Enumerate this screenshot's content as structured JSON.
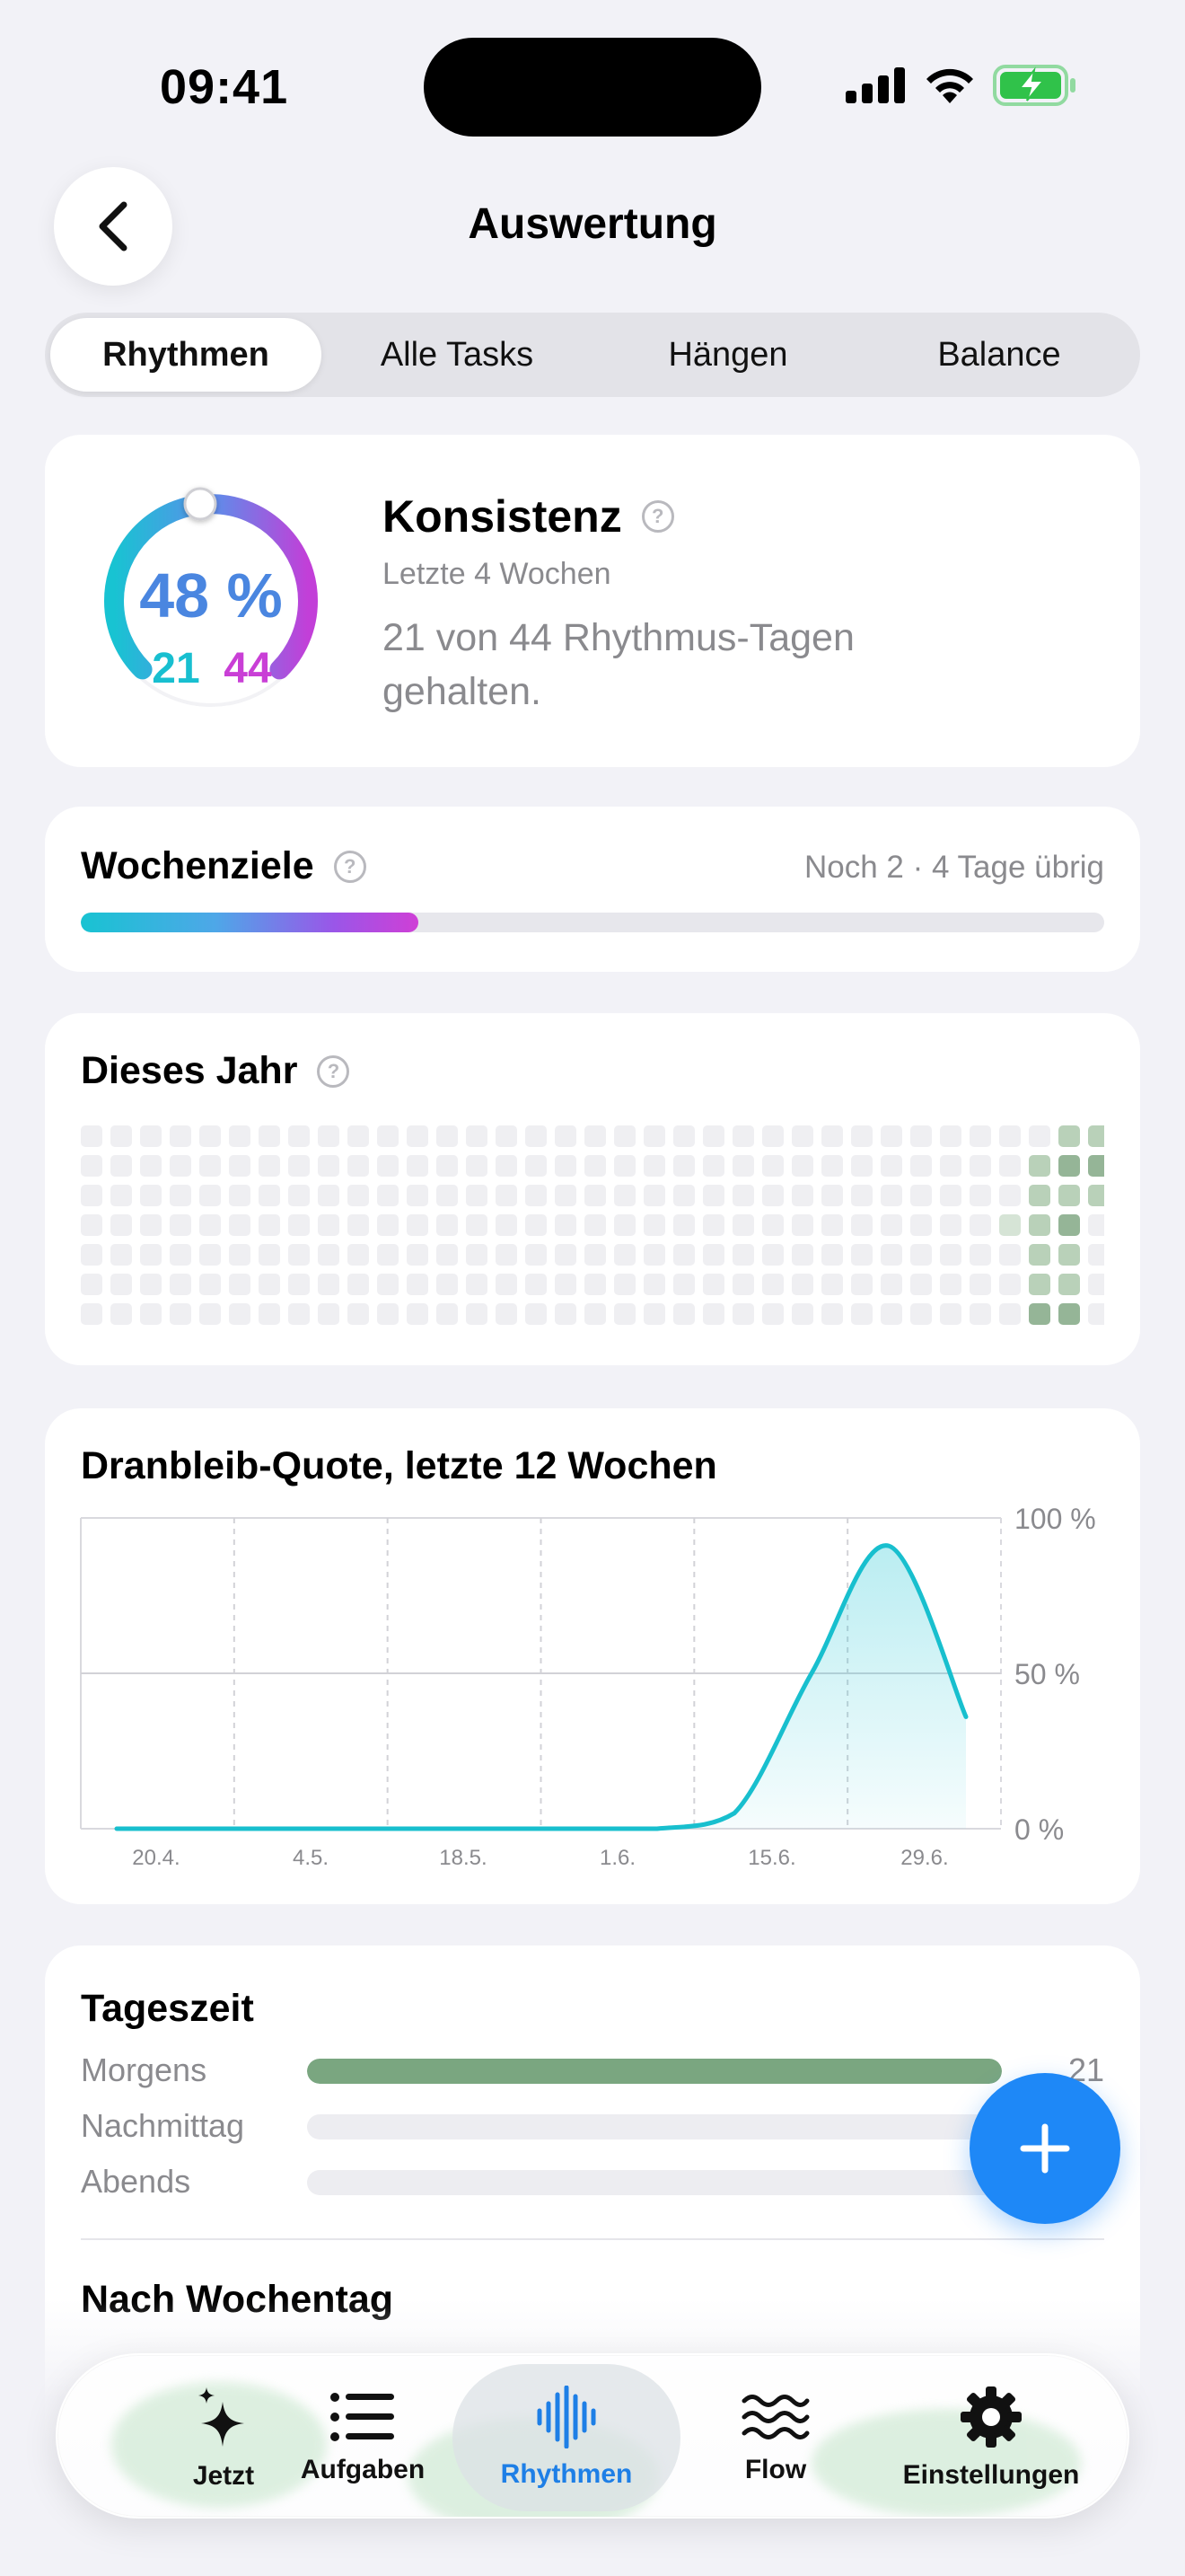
{
  "status": {
    "time": "09:41"
  },
  "nav": {
    "title": "Auswertung"
  },
  "segments": [
    {
      "label": "Rhythmen",
      "active": true
    },
    {
      "label": "Alle Tasks",
      "active": false
    },
    {
      "label": "Hängen",
      "active": false
    },
    {
      "label": "Balance",
      "active": false
    }
  ],
  "consistency": {
    "percent_label": "48 %",
    "kept": "21",
    "total": "44",
    "title": "Konsistenz",
    "subtitle": "Letzte 4 Wochen",
    "text": "21 von 44 Rhythmus-Tagen gehalten.",
    "fraction": 0.48
  },
  "weekly_goals": {
    "title": "Wochenziele",
    "remaining": "Noch 2 · 4 Tage übrig",
    "progress": 0.33
  },
  "year": {
    "title": "Dieses Jahr"
  },
  "chart_data": {
    "type": "area",
    "title": "Dranbleib-Quote, letzte 12 Wochen",
    "xlabel": "",
    "ylabel": "",
    "x_ticks": [
      "20.4.",
      "4.5.",
      "18.5.",
      "1.6.",
      "15.6.",
      "29.6."
    ],
    "y_ticks": [
      "100 %",
      "50 %",
      "0 %"
    ],
    "ylim": [
      0,
      100
    ],
    "grid": true,
    "series": [
      {
        "values": [
          0,
          0,
          0,
          0,
          0,
          0,
          0,
          0,
          5,
          50,
          91,
          36
        ]
      }
    ]
  },
  "time_of_day": {
    "title": "Tageszeit",
    "rows": [
      {
        "label": "Morgens",
        "value": "21",
        "fraction": 1.0
      },
      {
        "label": "Nachmittag",
        "value": "",
        "fraction": 0
      },
      {
        "label": "Abends",
        "value": "",
        "fraction": 0
      }
    ]
  },
  "by_weekday": {
    "title": "Nach Wochentag"
  },
  "tabs": [
    {
      "label": "Jetzt",
      "icon": "sparkles-icon"
    },
    {
      "label": "Aufgaben",
      "icon": "list-icon"
    },
    {
      "label": "Rhythmen",
      "icon": "waveform-icon",
      "active": true
    },
    {
      "label": "Flow",
      "icon": "water-waves-icon"
    },
    {
      "label": "Einstellungen",
      "icon": "gear-icon"
    }
  ],
  "colors": {
    "accent": "#1E88F7",
    "teal": "#18C3D2",
    "magenta": "#C93FD6",
    "green": "#7AA680"
  }
}
